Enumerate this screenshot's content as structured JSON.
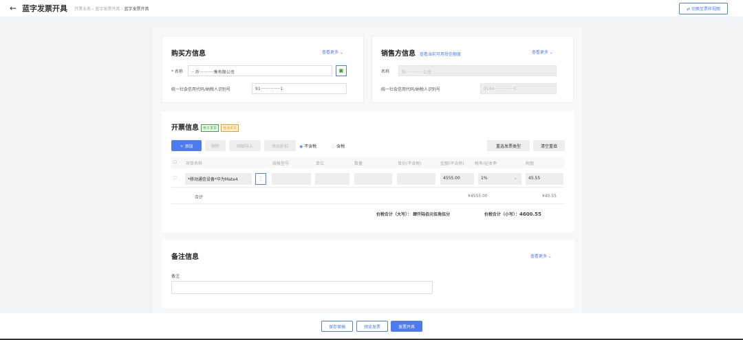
{
  "header": {
    "title": "蓝字发票开具",
    "breadcrumb": [
      "开票业务",
      "蓝字发票开具",
      "蓝字发票开具"
    ],
    "switch_label": "⇄ 切换至票样视图"
  },
  "buyer": {
    "title": "购买方信息",
    "more": "查看更多 ⌄",
    "name_label": "* 名称",
    "name_value": "·· 市···········售有限公司",
    "tax_label": "统一社会信用代码/纳税人识别号",
    "tax_value": "91···············1"
  },
  "seller": {
    "title": "销售方信息",
    "quota_link": "查看当前可用授信额度",
    "more": "查看更多 ⌄",
    "name_label": "名称",
    "name_value": "料·············公司",
    "tax_label": "统一社会信用代码/纳税人识别号",
    "tax_value": "9144···············C"
  },
  "invoice": {
    "title": "开票信息",
    "tag1": "电子发票",
    "tag2": "普通发票",
    "add": "+ 添加",
    "delete": "删除",
    "import": "明细导入",
    "discount": "添加折扣",
    "radio_excl": "不含税",
    "radio_incl": "含税",
    "reselect": "重选发票类型",
    "clear": "清空重填",
    "columns": [
      "项目名称",
      "规格型号",
      "单位",
      "数量",
      "单价(不含税)",
      "金额(不含税)",
      "税率/征收率",
      "税额"
    ],
    "row": {
      "name": "*移动通信设备*华为Mate4",
      "amount": "4555.00",
      "rate": "1%",
      "tax": "45.55"
    },
    "total_label": "合计",
    "total_amount": "¥4555.00",
    "total_tax": "¥45.55",
    "upper_label": "价税合计（大写）：",
    "upper_value": "肆仟陆佰元伍角伍分",
    "lower_label": "价税合计（小写）：",
    "lower_value": "4600.55"
  },
  "remark": {
    "title": "备注信息",
    "more": "查看更多 ⌄",
    "label": "备注"
  },
  "footer": {
    "save": "保存草稿",
    "preview": "预览发票",
    "issue": "发票开具"
  }
}
